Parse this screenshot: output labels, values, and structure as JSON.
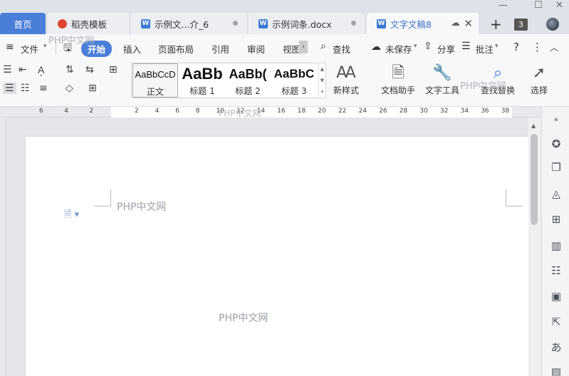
{
  "tabs": {
    "home": "首页",
    "items": [
      {
        "label": "稻壳模板",
        "icon": "wps-docer-icon"
      },
      {
        "label": "示例文...介_6",
        "icon": "word-doc-icon"
      },
      {
        "label": "示例词条.docx",
        "icon": "word-doc-icon"
      },
      {
        "label": "文字文稿8",
        "icon": "word-doc-icon"
      }
    ],
    "plus": "+",
    "count": "3"
  },
  "menu": {
    "file": "文件",
    "start": "开始",
    "insert": "插入",
    "layout": "页面布局",
    "reference": "引用",
    "review": "审阅",
    "view": "视图",
    "find": "查找",
    "unsaved": "未保存",
    "share": "分享",
    "comment": "批注"
  },
  "ribbon": {
    "styles": [
      {
        "preview": "AaBbCcD",
        "name": "正文"
      },
      {
        "preview": "AaBb",
        "name": "标题 1"
      },
      {
        "preview": "AaBb(",
        "name": "标题 2"
      },
      {
        "preview": "AaBbC",
        "name": "标题 3"
      }
    ],
    "new_style": "新样式",
    "doc_assistant": "文档助手",
    "text_tools": "文字工具",
    "find_replace": "查找替换",
    "select": "选择"
  },
  "ruler": {
    "numbers": [
      "6",
      "4",
      "2",
      "2",
      "4",
      "6",
      "8",
      "10",
      "12",
      "14",
      "16",
      "18",
      "20",
      "22",
      "24",
      "26",
      "28",
      "30",
      "32",
      "34",
      "36",
      "38"
    ]
  },
  "watermarks": [
    "PHP中文网",
    "PHP中文网",
    "PHP中文网",
    "PHP中文网",
    "PHP中文网"
  ]
}
